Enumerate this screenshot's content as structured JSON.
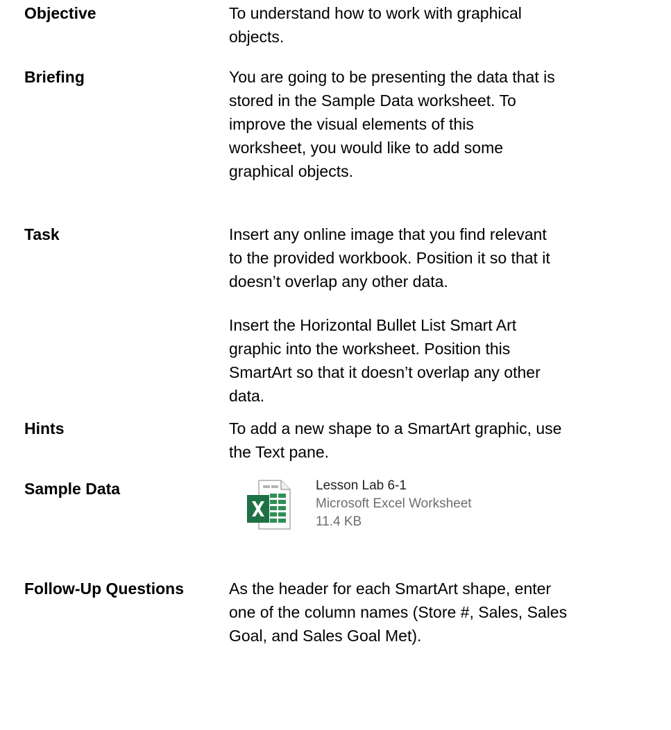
{
  "rows": {
    "objective": {
      "label": "Objective",
      "text": "To understand how to work with graphical\nobjects."
    },
    "briefing": {
      "label": "Briefing",
      "text": "You are going to be presenting the data that is\nstored in the Sample Data worksheet. To\nimprove the visual elements of this\nworksheet, you would like to add some\ngraphical objects."
    },
    "task": {
      "label": "Task",
      "text_1": "Insert any online image that you find relevant\nto the provided workbook. Position it so that it\ndoesn’t overlap any other data.",
      "text_2": "Insert the Horizontal Bullet List Smart Art\ngraphic into the worksheet. Position this\nSmartArt so that it doesn’t overlap any other\ndata."
    },
    "hints": {
      "label": "Hints",
      "text": "To add a new shape to a SmartArt graphic, use\nthe Text pane."
    },
    "sample_data": {
      "label": "Sample Data",
      "attachment": {
        "icon": "excel-file-icon",
        "name": "Lesson Lab 6-1",
        "type": "Microsoft Excel Worksheet",
        "size": "11.4 KB",
        "brand_color": "#1e7145"
      }
    },
    "follow_up": {
      "label": "Follow-Up Questions",
      "text": "As the header for each SmartArt shape, enter\none of the column names (Store #, Sales, Sales\nGoal, and Sales Goal Met)."
    }
  }
}
